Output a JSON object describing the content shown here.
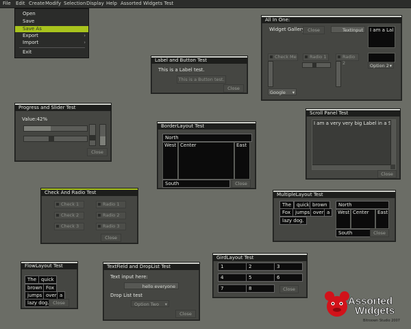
{
  "menubar": [
    "File",
    "Edit",
    "Create",
    "Modify",
    "Selection",
    "Display",
    "Help",
    "Assorted Widgets Test"
  ],
  "file_menu": {
    "items": [
      {
        "label": "Open",
        "arrow": ""
      },
      {
        "label": "Save",
        "arrow": ""
      },
      {
        "label": "Save As",
        "arrow": "",
        "highlight": true
      },
      {
        "label": "Export",
        "arrow": "›"
      },
      {
        "label": "Import",
        "arrow": "›"
      },
      {
        "label": "Exit",
        "arrow": ""
      }
    ]
  },
  "label_button": {
    "title": "Label and Button Test",
    "label": "This is a Label test.",
    "button": "This is a Button test.",
    "close": "Close"
  },
  "progress_slider": {
    "title": "Progress and Slider Test",
    "value_text": "Value:42%",
    "progress": 0.42,
    "close": "Close"
  },
  "check_radio": {
    "title": "Check And Radio Test",
    "checks": [
      "Check 1",
      "Check 2",
      "Check 3"
    ],
    "radios": [
      "Radio 1",
      "Radio 2",
      "Radio 3"
    ],
    "close": "Close"
  },
  "flow_layout": {
    "title": "FlowLayout Test",
    "words": [
      "The",
      "quick",
      "brown",
      "Fox",
      "jumps",
      "over",
      "a",
      "lazy dog."
    ],
    "close": "Close"
  },
  "textfield": {
    "title": "TextField and DropList Test",
    "input_label": "Text input here:",
    "input_value": "hello everyone",
    "droplist_label": "Drop List test",
    "droplist_value": "Option Two",
    "close": "Close"
  },
  "border_layout": {
    "title": "BorderLayout Test",
    "north": "North",
    "west": "West",
    "center": "Center",
    "east": "East",
    "south": "South",
    "close": "Close"
  },
  "grid_layout": {
    "title": "GirdLayout Test",
    "cells": [
      "1",
      "2",
      "3",
      "4",
      "5",
      "6",
      "7",
      "8"
    ],
    "close": "Close"
  },
  "multiple_layout": {
    "title": "MultipleLayout Test",
    "words": [
      "The",
      "quick",
      "brown",
      "Fox",
      "jumps",
      "over",
      "a",
      "lazy dog."
    ],
    "north": "North",
    "west": "West",
    "center": "Center",
    "east": "East",
    "south": "South",
    "close": "Close"
  },
  "scroll_panel": {
    "title": "Scroll Panel Test",
    "text": "I am a very very big Label in a Scroll P",
    "close": "Close"
  },
  "all_in_one": {
    "title": "All In One:",
    "gallery_label": "Widget Gallery",
    "close": "Close",
    "textinput": "TextInput",
    "label_text": "I am a Label",
    "check": "Check Me",
    "radio1": "Radio 1",
    "radio2": "Radio 2",
    "option": "Option 2",
    "google": "Google"
  },
  "logo": {
    "line1": "Assorted",
    "line2": "Widgets",
    "credit": "Bitroown Studio 2007"
  },
  "colors": {
    "accent": "#a9c41d",
    "window": "#454642",
    "background": "#6b6d66"
  }
}
